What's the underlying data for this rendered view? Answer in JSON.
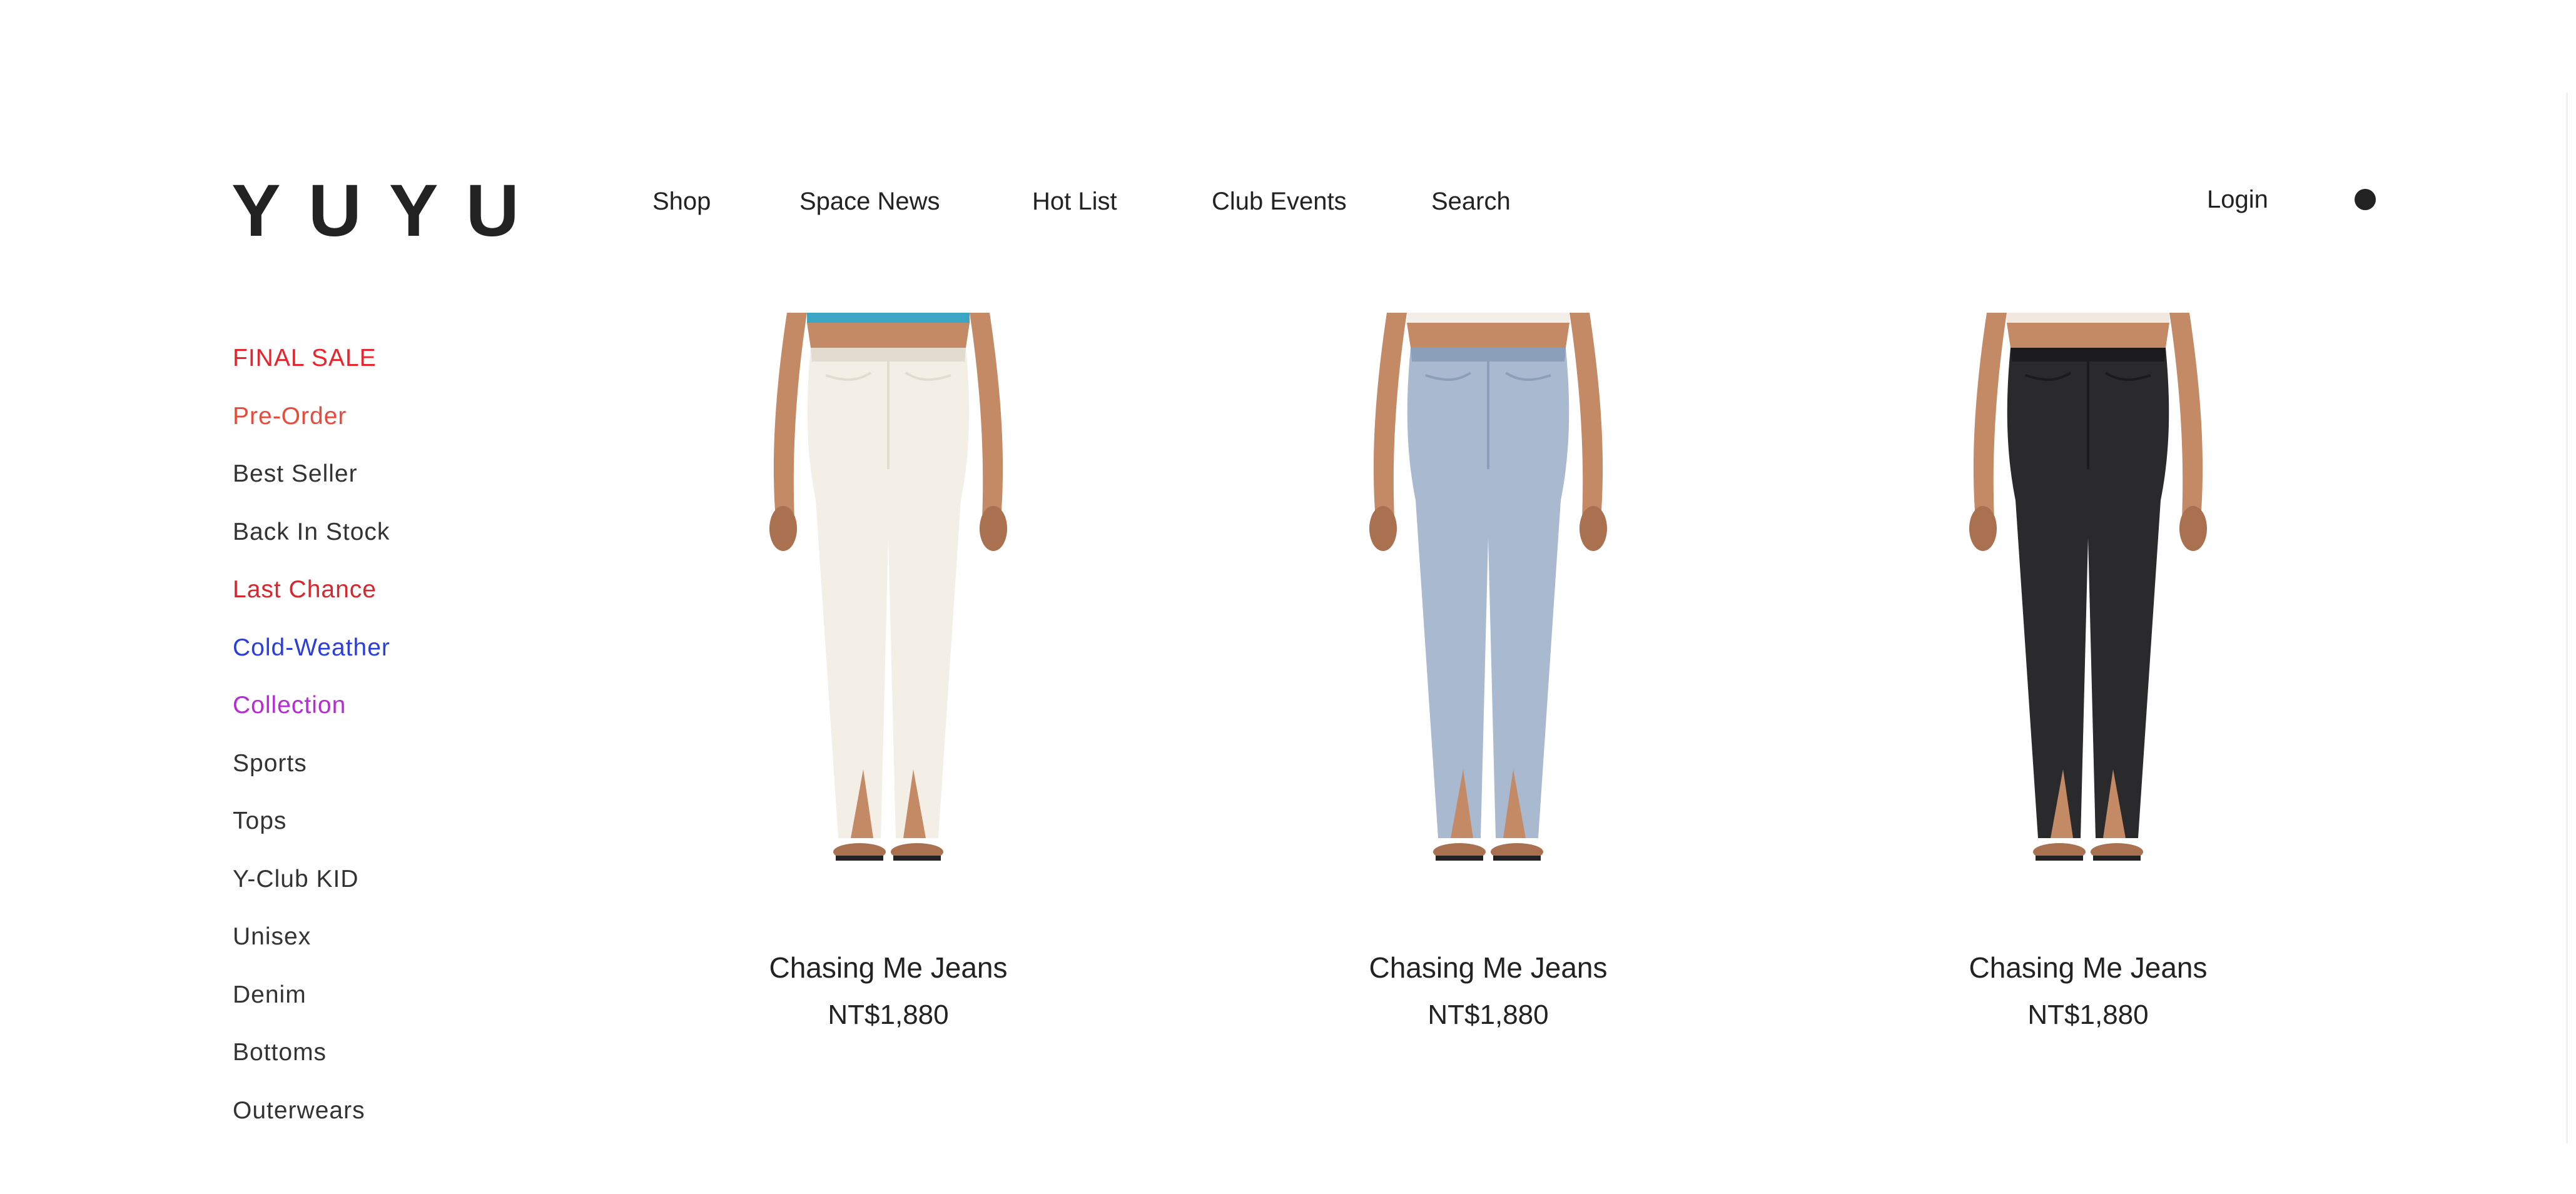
{
  "brand": {
    "logo": "YUYU"
  },
  "nav": {
    "items": [
      "Shop",
      "Space News",
      "Hot List",
      "Club Events",
      "Search"
    ]
  },
  "account": {
    "login": "Login"
  },
  "sidebar": {
    "categories": [
      {
        "label": "FINAL SALE",
        "color": "#e8242c"
      },
      {
        "label": "Pre-Order",
        "color": "#ea4a3a"
      },
      {
        "label": "Best Seller",
        "color": "#333333"
      },
      {
        "label": "Back In Stock",
        "color": "#333333"
      },
      {
        "label": "Last Chance",
        "color": "#d4282e"
      },
      {
        "label": "Cold-Weather",
        "color": "#2a3de0"
      },
      {
        "label": "Collection",
        "color": "#b62bd6"
      },
      {
        "label": "Sports",
        "color": "#333333"
      },
      {
        "label": "Tops",
        "color": "#333333"
      },
      {
        "label": "Y-Club KID",
        "color": "#333333"
      },
      {
        "label": "Unisex",
        "color": "#333333"
      },
      {
        "label": "Denim",
        "color": "#333333"
      },
      {
        "label": "Bottoms",
        "color": "#333333"
      },
      {
        "label": "Outerwears",
        "color": "#333333"
      }
    ]
  },
  "products": [
    {
      "name": "Chasing Me Jeans",
      "price": "NT$1,880",
      "jean_color": "#f3efe7",
      "jean_shade": "#e2dccf",
      "top_color": "#3aa6c4"
    },
    {
      "name": "Chasing Me Jeans",
      "price": "NT$1,880",
      "jean_color": "#a9b9cf",
      "jean_shade": "#8c9fba",
      "top_color": "#f4eee8"
    },
    {
      "name": "Chasing Me Jeans",
      "price": "NT$1,880",
      "jean_color": "#2a2a2c",
      "jean_shade": "#1b1b1d",
      "top_color": "#f1e8df"
    }
  ],
  "colors": {
    "text": "#222222",
    "skin": "#c48a66",
    "skin_shade": "#a9714f"
  }
}
